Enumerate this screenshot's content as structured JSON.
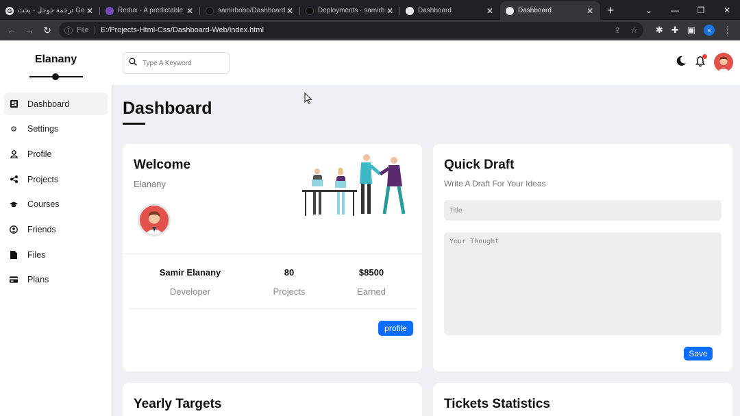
{
  "browser": {
    "tabs": [
      {
        "title": "ترجمة جوجل - بحث Google",
        "favicon": "google-icon"
      },
      {
        "title": "Redux - A predictable",
        "favicon": "redux-icon"
      },
      {
        "title": "samirbobo/Dashboard",
        "favicon": "github-icon"
      },
      {
        "title": "Deployments · samirb",
        "favicon": "github-icon"
      },
      {
        "title": "Dashboard",
        "favicon": "globe-icon"
      },
      {
        "title": "Dashboard",
        "favicon": "globe-icon"
      }
    ],
    "url_scheme": "File",
    "url": "E:/Projects-Html-Css/Dashboard-Web/index.html",
    "profile_initial": "s"
  },
  "sidebar": {
    "brand": "Elanany",
    "items": [
      {
        "label": "Dashboard",
        "icon": "dashboard-icon",
        "active": true
      },
      {
        "label": "Settings",
        "icon": "gear-icon"
      },
      {
        "label": "Profile",
        "icon": "user-icon"
      },
      {
        "label": "Projects",
        "icon": "share-icon"
      },
      {
        "label": "Courses",
        "icon": "graduation-cap-icon"
      },
      {
        "label": "Friends",
        "icon": "user-circle-icon"
      },
      {
        "label": "Files",
        "icon": "file-icon"
      },
      {
        "label": "Plans",
        "icon": "credit-card-icon"
      }
    ]
  },
  "header": {
    "search_placeholder": "Type A Keyword"
  },
  "main": {
    "title": "Dashboard",
    "welcome": {
      "title": "Welcome",
      "subtitle": "Elanany",
      "stats": [
        {
          "value": "Samir Elanany",
          "label": "Developer"
        },
        {
          "value": "80",
          "label": "Projects"
        },
        {
          "value": "$8500",
          "label": "Earned"
        }
      ],
      "button": "profile"
    },
    "quick_draft": {
      "title": "Quick Draft",
      "subtitle": "Write A Draft For Your Ideas",
      "title_placeholder": "Title",
      "thought_placeholder": "Your Thought",
      "button": "Save"
    },
    "yearly_title": "Yearly Targets",
    "tickets_title": "Tickets Statistics"
  },
  "colors": {
    "accent": "#0d6efd",
    "page_bg": "#eef0f3",
    "badge": "#f44336"
  }
}
